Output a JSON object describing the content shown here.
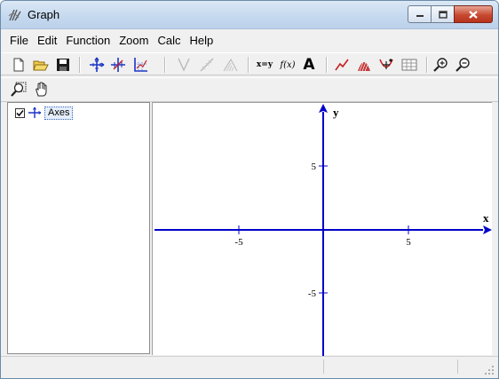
{
  "window": {
    "title": "Graph"
  },
  "menu": [
    "File",
    "Edit",
    "Function",
    "Zoom",
    "Calc",
    "Help"
  ],
  "toolbar": {
    "row1": [
      "new-file-icon",
      "open-folder-icon",
      "save-icon",
      "insert-axes-icon",
      "axes-cross-icon",
      "axes-grid-icon",
      "tangent-icon",
      "shade-line-icon",
      "hatch-icon",
      "xy-icon",
      "fx-icon",
      "text-A-icon",
      "line-series-icon",
      "area-icon",
      "point-series-icon",
      "table-icon",
      "zoom-in-icon",
      "zoom-out-icon"
    ],
    "row2": [
      "zoom-window-icon",
      "hand-move-icon"
    ]
  },
  "toolbar_labels": {
    "xy": "x=y",
    "fx": "f(x)",
    "text": "A"
  },
  "tree": {
    "items": [
      {
        "label": "Axes",
        "checked": true
      }
    ]
  },
  "graph": {
    "x_label": "x",
    "y_label": "y",
    "tick_labels": {
      "x_neg": "-5",
      "x_pos": "5",
      "y_pos": "5",
      "y_neg": "-5"
    },
    "axis_color": "#0000c8",
    "x_range": [
      -10,
      10
    ],
    "y_range": [
      -8,
      8
    ]
  }
}
